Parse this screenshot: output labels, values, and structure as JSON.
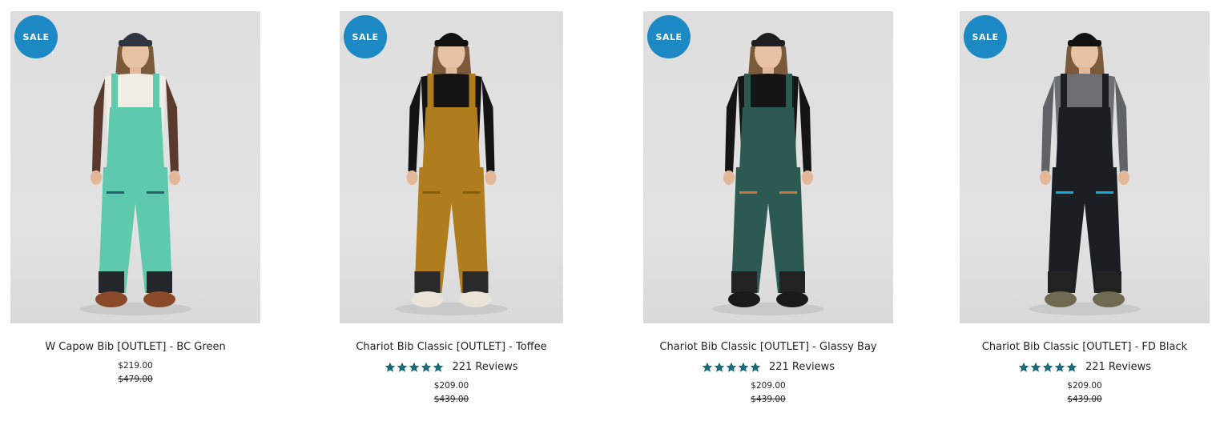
{
  "products": [
    {
      "badge": "SALE",
      "title": "W Capow Bib [OUTLET] - BC Green",
      "price": "$219.00",
      "original_price": "$479.00",
      "has_reviews": false,
      "rating": null,
      "reviews_label": "",
      "colors": {
        "pants": "#5fc9ad",
        "top": "#f2ede4",
        "sleeve": "#5b3a2e",
        "hat": "#2f3440",
        "accent": "#2b5f6b",
        "boots": "#8a4a2a",
        "cuff": "#23262a"
      }
    },
    {
      "badge": "SALE",
      "title": "Chariot Bib Classic [OUTLET] - Toffee",
      "price": "$209.00",
      "original_price": "$439.00",
      "has_reviews": true,
      "rating": 5,
      "reviews_label": "221 Reviews",
      "colors": {
        "pants": "#b07d1e",
        "top": "#141414",
        "sleeve": "#141414",
        "hat": "#111111",
        "accent": "#8a5d12",
        "boots": "#e9e3da",
        "cuff": "#2a2a2a"
      }
    },
    {
      "badge": "SALE",
      "title": "Chariot Bib Classic [OUTLET] - Glassy Bay",
      "price": "$209.00",
      "original_price": "$439.00",
      "has_reviews": true,
      "rating": 5,
      "reviews_label": "221 Reviews",
      "colors": {
        "pants": "#2c5a52",
        "top": "#151515",
        "sleeve": "#151515",
        "hat": "#1f1f22",
        "accent": "#c47a3a",
        "boots": "#1a1a1a",
        "cuff": "#222"
      }
    },
    {
      "badge": "SALE",
      "title": "Chariot Bib Classic [OUTLET] - FD Black",
      "price": "$209.00",
      "original_price": "$439.00",
      "has_reviews": true,
      "rating": 5,
      "reviews_label": "221 Reviews",
      "colors": {
        "pants": "#1b1e22",
        "top": "#6c6f74",
        "sleeve": "#5f6267",
        "hat": "#111111",
        "accent": "#17a6d9",
        "boots": "#6f6a4f",
        "cuff": "#222"
      }
    }
  ],
  "theme": {
    "sale_badge_color": "#1c89c4",
    "star_color": "#1a6b7a"
  }
}
